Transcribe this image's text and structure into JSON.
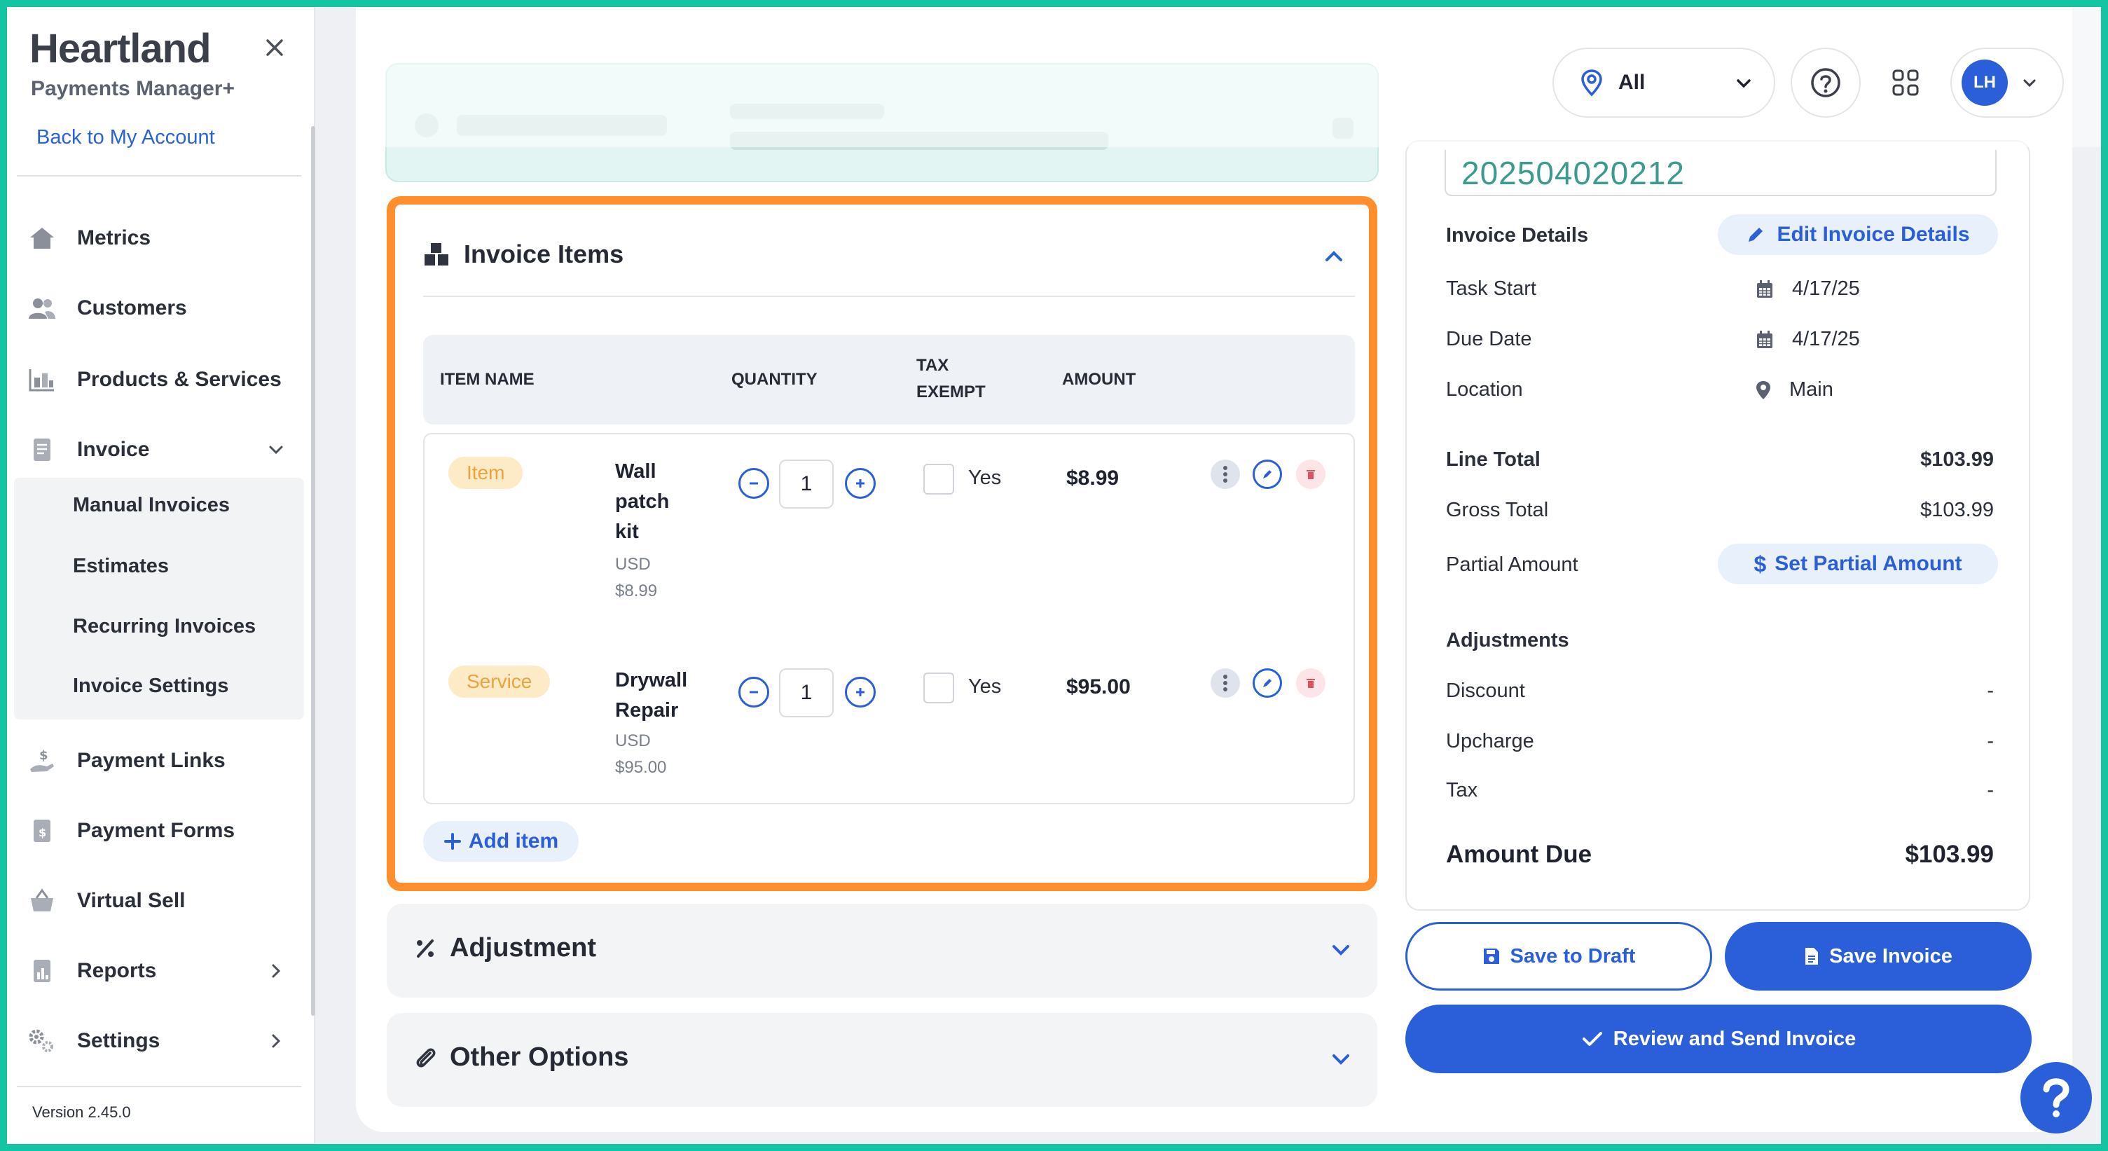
{
  "sidebar": {
    "brand": "Heartland",
    "sub_brand": "Payments Manager+",
    "back_link": "Back to My Account",
    "nav": [
      {
        "label": "Metrics",
        "icon": "home-icon"
      },
      {
        "label": "Customers",
        "icon": "users-icon"
      },
      {
        "label": "Products & Services",
        "icon": "warehouse-icon"
      },
      {
        "label": "Invoice",
        "icon": "document-icon"
      },
      {
        "label": "Payment Links",
        "icon": "hand-dollar-icon"
      },
      {
        "label": "Payment Forms",
        "icon": "form-icon"
      },
      {
        "label": "Virtual Sell",
        "icon": "basket-icon"
      },
      {
        "label": "Reports",
        "icon": "report-icon"
      },
      {
        "label": "Settings",
        "icon": "gear-icon"
      }
    ],
    "invoice_sub": [
      "Manual Invoices",
      "Estimates",
      "Recurring Invoices",
      "Invoice Settings"
    ],
    "version": "Version 2.45.0"
  },
  "header": {
    "location": "All"
  },
  "avatar": {
    "initials": "LH"
  },
  "invoice_items": {
    "title": "Invoice Items",
    "columns": {
      "item_name": "ITEM NAME",
      "quantity": "QUANTITY",
      "tax_exempt_1": "TAX",
      "tax_exempt_2": "EXEMPT",
      "amount": "AMOUNT"
    },
    "rows": [
      {
        "type": "Item",
        "name_lines": [
          "Wall",
          "patch",
          "kit"
        ],
        "currency": "USD",
        "unit_price": "$8.99",
        "quantity": "1",
        "tax_label": "Yes",
        "amount": "$8.99"
      },
      {
        "type": "Service",
        "name_lines": [
          "Drywall",
          "Repair"
        ],
        "currency": "USD",
        "unit_price": "$95.00",
        "quantity": "1",
        "tax_label": "Yes",
        "amount": "$95.00"
      }
    ],
    "add_item": "Add item"
  },
  "sections": {
    "adjustment": "Adjustment",
    "other_options": "Other Options"
  },
  "summary": {
    "invoice_number": "202504020212",
    "invoice_details_label": "Invoice Details",
    "edit_details": "Edit Invoice Details",
    "task_start_label": "Task Start",
    "task_start": "4/17/25",
    "due_date_label": "Due Date",
    "due_date": "4/17/25",
    "location_label": "Location",
    "location": "Main",
    "line_total_label": "Line Total",
    "line_total": "$103.99",
    "gross_total_label": "Gross Total",
    "gross_total": "$103.99",
    "partial_amount_label": "Partial Amount",
    "set_partial": "Set Partial Amount",
    "adjustments_label": "Adjustments",
    "discount_label": "Discount",
    "discount": "-",
    "upcharge_label": "Upcharge",
    "upcharge": "-",
    "tax_label": "Tax",
    "tax": "-",
    "amount_due_label": "Amount Due",
    "amount_due": "$103.99"
  },
  "actions": {
    "save_draft": "Save to Draft",
    "save_invoice": "Save Invoice",
    "review_send": "Review and Send Invoice"
  },
  "colors": {
    "primary": "#2b5fd9",
    "highlight": "#ff8f2e",
    "frame": "#14c4a3",
    "invoice_number": "#3d9a8e"
  }
}
